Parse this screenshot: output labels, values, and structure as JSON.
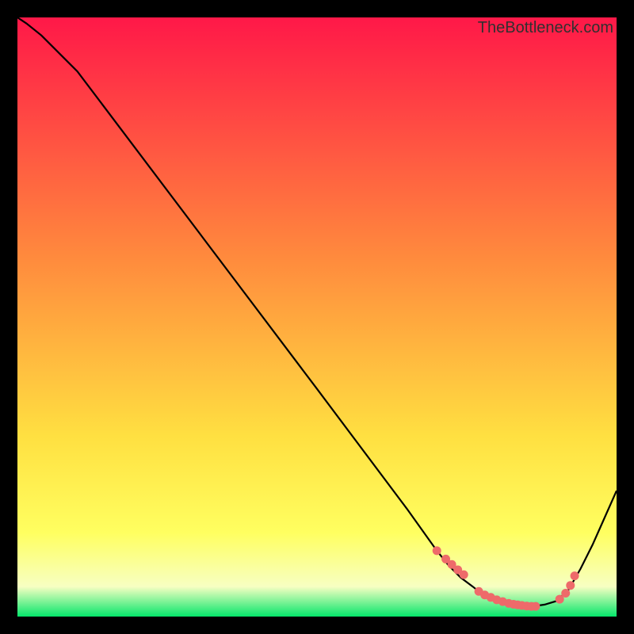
{
  "watermark": "TheBottleneck.com",
  "colors": {
    "stop_top": "#ff1848",
    "stop_mid1": "#ff8a3d",
    "stop_mid2": "#ffe041",
    "stop_mid3": "#ffff60",
    "stop_mid4": "#f7ffc2",
    "stop_bottom": "#05e66b",
    "curve": "#000000",
    "dot_fill": "#ee6a6a",
    "dot_stroke": "#ee6a6a"
  },
  "chart_data": {
    "type": "line",
    "title": "",
    "xlabel": "",
    "ylabel": "",
    "xlim": [
      0,
      100
    ],
    "ylim": [
      0,
      100
    ],
    "series": [
      {
        "name": "curve",
        "x": [
          0,
          1.5,
          4,
          10,
          50,
          65,
          70,
          72,
          74,
          76,
          77,
          78,
          80,
          82,
          84,
          86,
          88,
          90,
          92,
          94,
          96,
          100
        ],
        "y": [
          100,
          99,
          97,
          91,
          38,
          18,
          11,
          8.5,
          6.5,
          5,
          4.2,
          3.6,
          2.8,
          2.2,
          1.9,
          1.7,
          2.0,
          2.6,
          4.5,
          8.0,
          12,
          21
        ]
      }
    ],
    "dots": {
      "name": "bottom-cluster",
      "x": [
        70,
        71.5,
        72.5,
        73.5,
        74.5,
        77,
        78,
        79,
        80,
        81,
        82,
        82.8,
        83.5,
        84.2,
        85,
        85.8,
        86.5,
        90.5,
        91.5,
        92.3,
        93
      ],
      "y": [
        11,
        9.6,
        8.7,
        7.8,
        7.0,
        4.2,
        3.6,
        3.2,
        2.8,
        2.5,
        2.2,
        2.05,
        1.95,
        1.85,
        1.75,
        1.7,
        1.7,
        2.9,
        3.9,
        5.2,
        6.8
      ]
    }
  }
}
